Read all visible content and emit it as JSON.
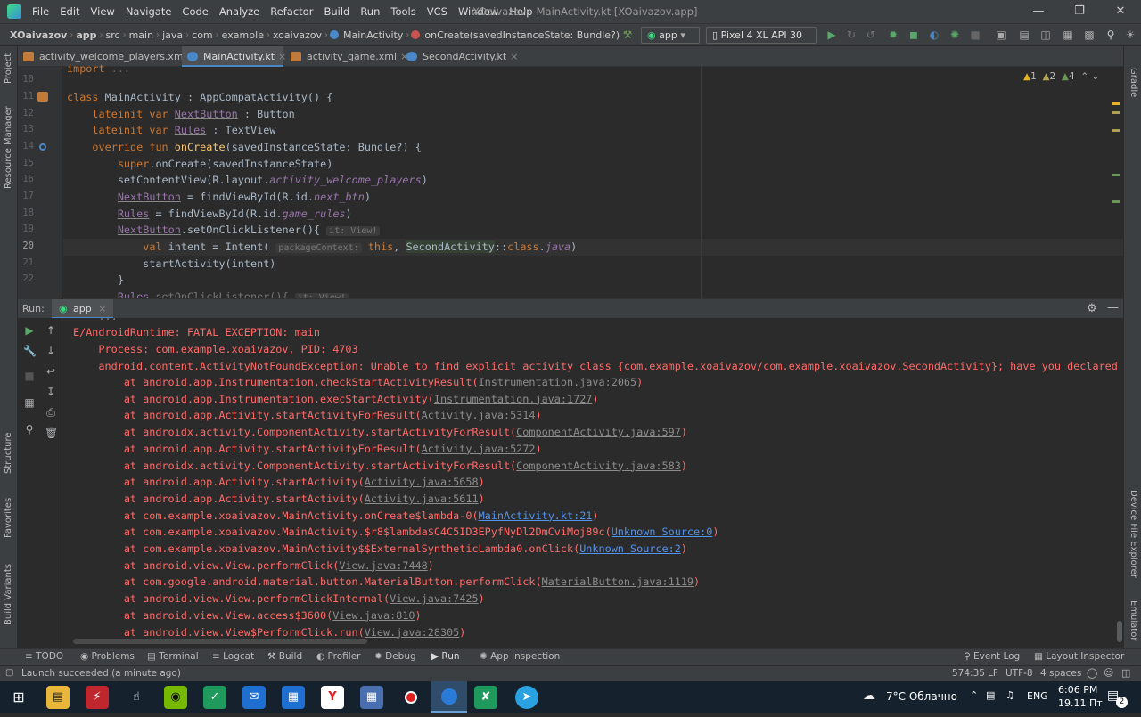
{
  "menubar": {
    "items": [
      "File",
      "Edit",
      "View",
      "Navigate",
      "Code",
      "Analyze",
      "Refactor",
      "Build",
      "Run",
      "Tools",
      "VCS",
      "Window",
      "Help"
    ],
    "window_title": "XOaivazov - MainActivity.kt [XOaivazov.app]"
  },
  "navbar": {
    "breadcrumbs": [
      "XOaivazov",
      "app",
      "src",
      "main",
      "java",
      "com",
      "example",
      "xoaivazov",
      "MainActivity",
      "onCreate(savedInstanceState: Bundle?)"
    ],
    "run_config": "app",
    "device": "Pixel 4 XL API 30"
  },
  "tabs": [
    "activity_welcome_players.xml",
    "MainActivity.kt",
    "activity_game.xml",
    "SecondActivity.kt"
  ],
  "side_tools": {
    "left": [
      "Project",
      "Resource Manager",
      "Structure",
      "Favorites",
      "Build Variants"
    ],
    "right": [
      "Gradle",
      "Device File Explorer",
      "Emulator"
    ]
  },
  "inspections": {
    "warnings": "1",
    "weak_warnings": "2",
    "typos": "4"
  },
  "editor": {
    "line_numbers": [
      "10",
      "11",
      "12",
      "13",
      "14",
      "15",
      "16",
      "17",
      "18",
      "19",
      "20",
      "21",
      "22"
    ],
    "hint_it_view": "it: View!",
    "hint_package_context": "packageContext:"
  },
  "run_panel": {
    "label": "Run:",
    "config": "app",
    "header_line": "E/AndroidRuntime: FATAL EXCEPTION: main",
    "process_line": "    Process: com.example.xoaivazov, PID: 4703",
    "exception_line": "    android.content.ActivityNotFoundException: Unable to find explicit activity class {com.example.xoaivazov/com.example.xoaivazov.SecondActivity}; have you declared",
    "stack": [
      {
        "text": "        at android.app.Instrumentation.checkStartActivityResult(",
        "link": "Instrumentation.java:2065",
        "tail": ")",
        "lt": "gry"
      },
      {
        "text": "        at android.app.Instrumentation.execStartActivity(",
        "link": "Instrumentation.java:1727",
        "tail": ")",
        "lt": "gry"
      },
      {
        "text": "        at android.app.Activity.startActivityForResult(",
        "link": "Activity.java:5314",
        "tail": ")",
        "lt": "gry"
      },
      {
        "text": "        at androidx.activity.ComponentActivity.startActivityForResult(",
        "link": "ComponentActivity.java:597",
        "tail": ")",
        "lt": "gry"
      },
      {
        "text": "        at android.app.Activity.startActivityForResult(",
        "link": "Activity.java:5272",
        "tail": ")",
        "lt": "gry"
      },
      {
        "text": "        at androidx.activity.ComponentActivity.startActivityForResult(",
        "link": "ComponentActivity.java:583",
        "tail": ")",
        "lt": "gry"
      },
      {
        "text": "        at android.app.Activity.startActivity(",
        "link": "Activity.java:5658",
        "tail": ")",
        "lt": "gry"
      },
      {
        "text": "        at android.app.Activity.startActivity(",
        "link": "Activity.java:5611",
        "tail": ")",
        "lt": "gry"
      },
      {
        "text": "        at com.example.xoaivazov.MainActivity.onCreate$lambda-0(",
        "link": "MainActivity.kt:21",
        "tail": ")",
        "lt": "lnk"
      },
      {
        "text": "        at com.example.xoaivazov.MainActivity.$r8$lambda$C4C5ID3EPyfNyDl2DmCviMoj89c(",
        "link": "Unknown Source:0",
        "tail": ")",
        "lt": "lnk"
      },
      {
        "text": "        at com.example.xoaivazov.MainActivity$$ExternalSyntheticLambda0.onClick(",
        "link": "Unknown Source:2",
        "tail": ")",
        "lt": "lnk"
      },
      {
        "text": "        at android.view.View.performClick(",
        "link": "View.java:7448",
        "tail": ")",
        "lt": "gry"
      },
      {
        "text": "        at com.google.android.material.button.MaterialButton.performClick(",
        "link": "MaterialButton.java:1119",
        "tail": ")",
        "lt": "gry"
      },
      {
        "text": "        at android.view.View.performClickInternal(",
        "link": "View.java:7425",
        "tail": ")",
        "lt": "gry"
      },
      {
        "text": "        at android.view.View.access$3600(",
        "link": "View.java:810",
        "tail": ")",
        "lt": "gry"
      },
      {
        "text": "        at android.view.View$PerformClick.run(",
        "link": "View.java:28305",
        "tail": ")",
        "lt": "gry"
      }
    ]
  },
  "bottom_tabs": [
    "TODO",
    "Problems",
    "Terminal",
    "Logcat",
    "Build",
    "Profiler",
    "Debug",
    "Run",
    "App Inspection"
  ],
  "bottom_right_tabs": [
    "Event Log",
    "Layout Inspector"
  ],
  "status": {
    "message": "Launch succeeded (a minute ago)",
    "position": "574:35",
    "line_sep": "LF",
    "encoding": "UTF-8",
    "indent": "4 spaces"
  },
  "taskbar": {
    "weather": "7°C  Облачно",
    "lang": "ENG",
    "time": "6:06 PM",
    "date": "19.11 Пт",
    "badge": "2"
  },
  "colors": {
    "accent": "#4a88c7",
    "error": "#ff6b68",
    "link": "#5394ec",
    "keyword": "#cc7832"
  }
}
